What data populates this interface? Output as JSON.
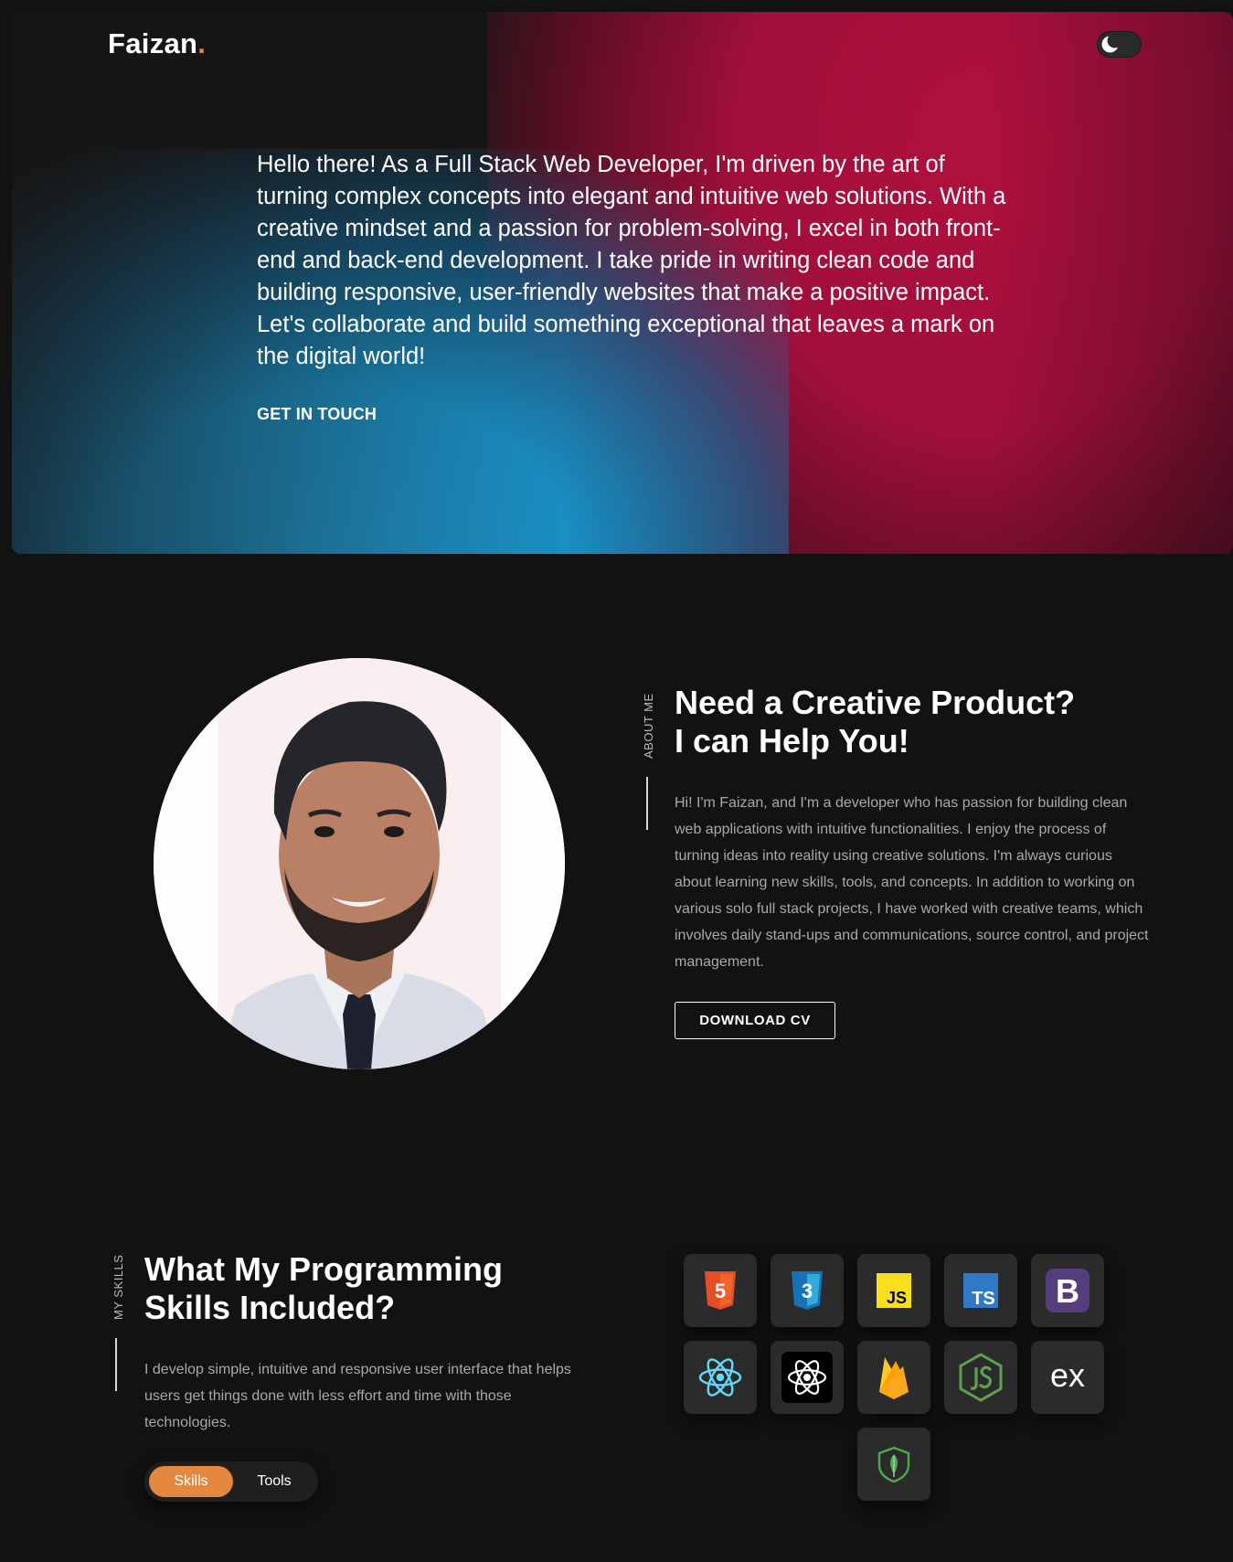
{
  "header": {
    "logo_text": "Faizan",
    "logo_dot": ".",
    "theme_toggle_icon": "moon-icon"
  },
  "hero": {
    "intro": "Hello there! As a Full Stack Web Developer, I'm driven by the art of turning complex concepts into elegant and intuitive web solutions. With a creative mindset and a passion for problem-solving, I excel in both front-end and back-end development. I take pride in writing clean code and building responsive, user-friendly websites that make a positive impact. Let's collaborate and build something exceptional that leaves a mark on the digital world!",
    "cta_label": "GET IN TOUCH"
  },
  "about": {
    "section_label": "ABOUT ME",
    "title_line1": "Need a Creative Product?",
    "title_line2": "I can Help You!",
    "description": "Hi! I'm Faizan, and I'm a developer who has passion for building clean web applications with intuitive functionalities. I enjoy the process of turning ideas into reality using creative solutions. I'm always curious about learning new skills, tools, and concepts. In addition to working on various solo full stack projects, I have worked with creative teams, which involves daily stand-ups and communications, source control, and project management.",
    "button_label": "DOWNLOAD CV"
  },
  "skills": {
    "section_label": "MY SKILLS",
    "title_line1": "What My Programming",
    "title_line2": "Skills Included?",
    "description": "I develop simple, intuitive and responsive user interface that helps users get things done with less effort and time with those technologies.",
    "toggle": {
      "active": "Skills",
      "inactive": "Tools"
    },
    "icons": [
      "html5-icon",
      "css3-icon",
      "javascript-icon",
      "typescript-icon",
      "bootstrap-icon",
      "react-icon",
      "react-native-icon",
      "firebase-icon",
      "nodejs-icon",
      "express-icon",
      "mongodb-icon"
    ],
    "icon_text": {
      "js": "JS",
      "ts": "TS",
      "bootstrap": "B",
      "express": "ex",
      "css_num": "3",
      "html_num": "5"
    }
  },
  "colors": {
    "accent": "#e5883f",
    "background": "#121212",
    "hero_red": "#a00f3a",
    "hero_blue": "#1f95c9"
  }
}
